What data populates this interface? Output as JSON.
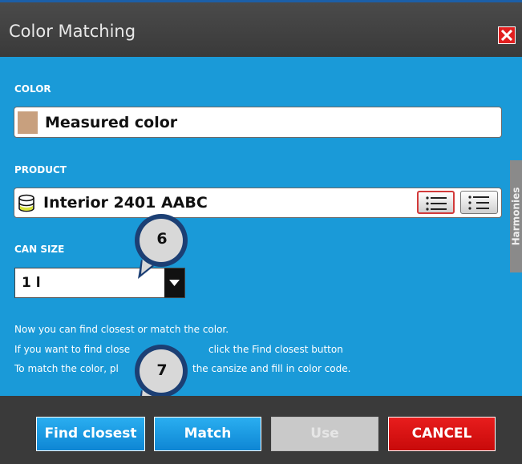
{
  "dialog": {
    "title": "Color Matching",
    "close_icon": "close-x-icon"
  },
  "color_section": {
    "label": "COLOR",
    "value": "Measured color",
    "swatch_color": "#c8a07e"
  },
  "product_section": {
    "label": "PRODUCT",
    "icon": "database-icon",
    "value": "Interior 2401 AABC",
    "list_buttons": [
      "list-icon",
      "list-detail-icon"
    ]
  },
  "side_tab": {
    "label": "Harmonies"
  },
  "can_size_section": {
    "label": "CAN SIZE",
    "selected": "1 l"
  },
  "instructions": {
    "line1": "Now you can find closest or match the color.",
    "line2_a": "If you want to find close",
    "line2_b": "click the Find closest button",
    "line3_a": "To match the color, pl",
    "line3_b": "the cansize and fill in color code."
  },
  "callouts": {
    "six": "6",
    "seven": "7"
  },
  "buttons": {
    "find_closest": "Find closest",
    "match": "Match",
    "use": "Use",
    "cancel": "CANCEL"
  },
  "colors": {
    "background": "#1a9ad8",
    "titlebar": "#3d3d3d",
    "cancel": "#e01414",
    "accent_button": "#1ea3e6"
  }
}
